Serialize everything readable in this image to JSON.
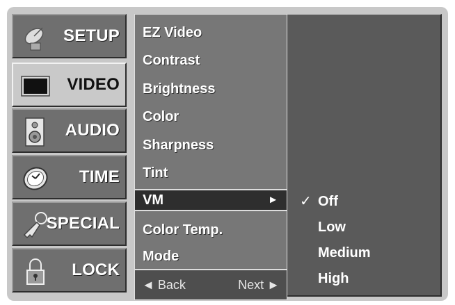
{
  "sidebar": {
    "items": [
      {
        "label": "SETUP",
        "icon": "satellite-dish-icon",
        "active": false
      },
      {
        "label": "VIDEO",
        "icon": "screen-icon",
        "active": true
      },
      {
        "label": "AUDIO",
        "icon": "speaker-icon",
        "active": false
      },
      {
        "label": "TIME",
        "icon": "clock-icon",
        "active": false
      },
      {
        "label": "SPECIAL",
        "icon": "key-icon",
        "active": false
      },
      {
        "label": "LOCK",
        "icon": "padlock-icon",
        "active": false
      }
    ]
  },
  "menu": {
    "items": [
      {
        "label": "EZ Video"
      },
      {
        "label": "Contrast"
      },
      {
        "label": "Brightness"
      },
      {
        "label": "Color"
      },
      {
        "label": "Sharpness"
      },
      {
        "label": "Tint"
      },
      {
        "label": "VM",
        "selected": true,
        "arrow": "►"
      },
      {
        "label": "Color Temp."
      },
      {
        "label": "Mode"
      }
    ],
    "nav": {
      "back": "◄ Back",
      "next": "Next ►"
    }
  },
  "submenu": {
    "items": [
      {
        "label": "Off",
        "checked": true,
        "check": "✓"
      },
      {
        "label": "Low"
      },
      {
        "label": "Medium"
      },
      {
        "label": "High"
      }
    ]
  },
  "colors": {
    "panel": "#c8c8c8",
    "menu": "#777777",
    "selected": "#2e2e2e",
    "submenu": "#5a5a5a"
  }
}
